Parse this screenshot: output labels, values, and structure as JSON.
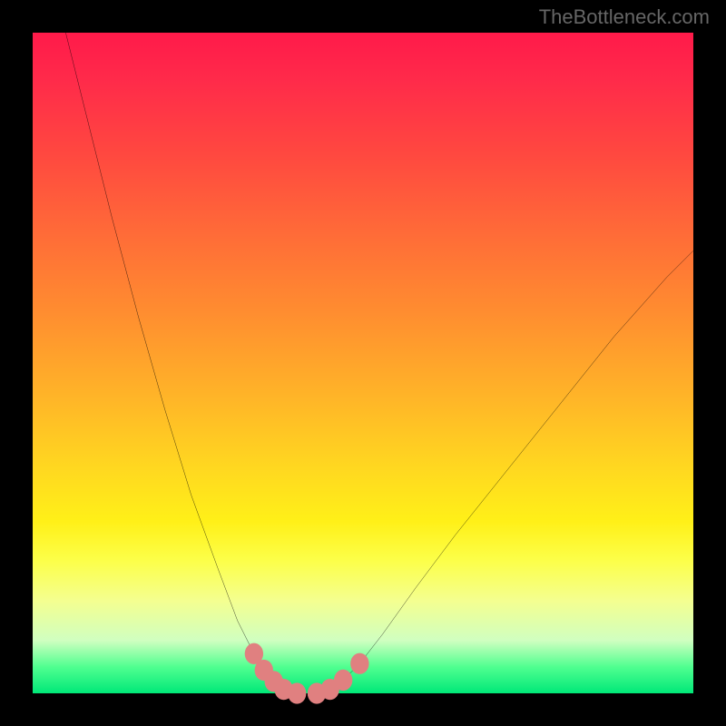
{
  "watermark": "TheBottleneck.com",
  "chart_data": {
    "type": "line",
    "title": "",
    "xlabel": "",
    "ylabel": "",
    "xlim": [
      0,
      100
    ],
    "ylim": [
      0,
      100
    ],
    "grid": false,
    "legend": false,
    "background_gradient": {
      "top": "#ff1a4a",
      "bottom": "#00e878",
      "stops": [
        {
          "pct": 0,
          "color": "#ff1a4a"
        },
        {
          "pct": 18,
          "color": "#ff4740"
        },
        {
          "pct": 42,
          "color": "#ff8c30"
        },
        {
          "pct": 66,
          "color": "#ffd820"
        },
        {
          "pct": 80,
          "color": "#fcff4a"
        },
        {
          "pct": 92,
          "color": "#d0ffc0"
        },
        {
          "pct": 100,
          "color": "#00e878"
        }
      ]
    },
    "series": [
      {
        "name": "left-curve",
        "stroke": "#000000",
        "x": [
          5,
          8,
          12,
          16,
          20,
          24,
          28,
          31,
          33.5,
          35,
          36.5,
          38,
          40
        ],
        "y": [
          100,
          88,
          72,
          57,
          43,
          30,
          19,
          11,
          6,
          3.5,
          1.8,
          0.6,
          0
        ]
      },
      {
        "name": "right-curve",
        "stroke": "#000000",
        "x": [
          43,
          45,
          47,
          49.5,
          53,
          58,
          64,
          72,
          80,
          88,
          96,
          100
        ],
        "y": [
          0,
          0.6,
          2,
          4.5,
          9,
          16,
          24,
          34,
          44,
          54,
          63,
          67
        ]
      },
      {
        "name": "valley-markers",
        "type": "scatter",
        "marker_color": "#e08080",
        "marker_size": 18,
        "x": [
          33.5,
          35,
          36.5,
          38,
          40,
          43,
          45,
          47,
          49.5
        ],
        "y": [
          6,
          3.5,
          1.8,
          0.6,
          0,
          0,
          0.6,
          2,
          4.5
        ]
      }
    ],
    "valley_x_range": [
      38,
      43
    ],
    "note": "V-shaped bottleneck curve; minimum (optimal zone) around x≈38–43. Values estimated from pixel positions; no axis tick labels present in source image."
  }
}
